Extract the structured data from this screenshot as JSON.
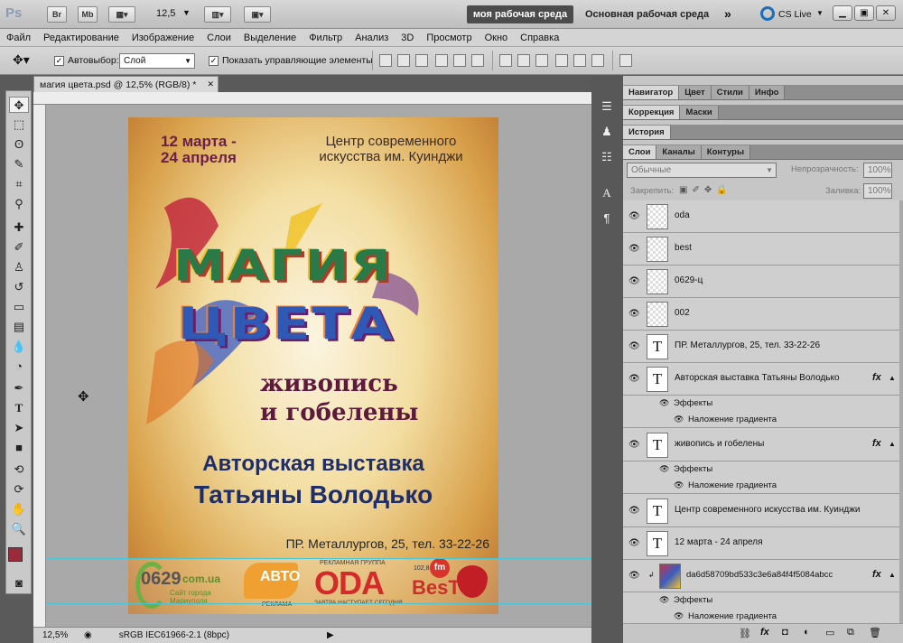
{
  "appbar": {
    "logo": "Ps",
    "bridge": "Br",
    "minibridge": "Mb",
    "zoom": "12,5",
    "workspace_active": "моя рабочая среда",
    "workspace_main": "Основная рабочая среда",
    "cslive": "CS Live"
  },
  "menu": [
    "Файл",
    "Редактирование",
    "Изображение",
    "Слои",
    "Выделение",
    "Фильтр",
    "Анализ",
    "3D",
    "Просмотр",
    "Окно",
    "Справка"
  ],
  "options": {
    "autoselect_label": "Автовыбор:",
    "autoselect_value": "Слой",
    "show_controls_label": "Показать управляющие элементы"
  },
  "document": {
    "tab_title": "магия цвета.psd @ 12,5% (RGB/8) *",
    "zoom_status": "12,5%",
    "profile_status": "sRGB IEC61966-2.1 (8bpc)"
  },
  "poster": {
    "date": "12 марта -\n24 апреля",
    "venue": "Центр современного\nискусства им. Куинджи",
    "title1": "МАГИЯ",
    "title2": "ЦВЕТА",
    "subtitle1": "живопись",
    "subtitle2": "и гобелены",
    "author1": "Авторская выставка",
    "author2": "Татьяны Володько",
    "address": "ПР. Металлургов, 25, тел. 33-22-26",
    "logo_0629": "0629",
    "logo_0629_suffix": "com.ua",
    "logo_0629_sub": "Сайт города\nМариуполя",
    "logo_avto": "АВТО",
    "logo_avto_sub": "РЕКЛАМА",
    "logo_oda_top": "РЕКЛАМНАЯ ГРУППА",
    "logo_oda": "ODA",
    "logo_oda_sub": "ЗАВТРА НАСТУПАЕТ СЕГОДНЯ",
    "logo_best": "BesT",
    "logo_best_fm": "fm",
    "logo_best_freq": "102,8"
  },
  "panels": {
    "top_tabs": [
      "Навигатор",
      "Цвет",
      "Стили",
      "Инфо"
    ],
    "second_tabs": [
      "Коррекция",
      "Маски"
    ],
    "history_tab": "История",
    "layers_tabs": [
      "Слои",
      "Каналы",
      "Контуры"
    ],
    "blend_mode": "Обычные",
    "opacity_label": "Непрозрачность:",
    "opacity_value": "100%",
    "lock_label": "Закрепить:",
    "fill_label": "Заливка:",
    "fill_value": "100%"
  },
  "layers": [
    {
      "name": "oda",
      "kind": "raster"
    },
    {
      "name": "best",
      "kind": "raster"
    },
    {
      "name": "0629-ц",
      "kind": "raster"
    },
    {
      "name": "002",
      "kind": "raster"
    },
    {
      "name": "ПР. Металлургов, 25, тел. 33-22-26",
      "kind": "text"
    },
    {
      "name": "Авторская выставка Татьяны Володько",
      "kind": "text",
      "fx": "fx"
    },
    {
      "name": "живопись и гобелены",
      "kind": "text",
      "fx": "fx"
    },
    {
      "name": "Центр современного  искусства  им. Куинджи",
      "kind": "text"
    },
    {
      "name": "12 марта - 24 апреля",
      "kind": "text"
    },
    {
      "name": "da6d58709bd533c3e6a84f4f5084abcc",
      "kind": "image",
      "fx": "fx"
    }
  ],
  "effects_label": "Эффекты",
  "gradient_overlay_label": "Наложение градиента",
  "text_thumb_glyph": "T"
}
